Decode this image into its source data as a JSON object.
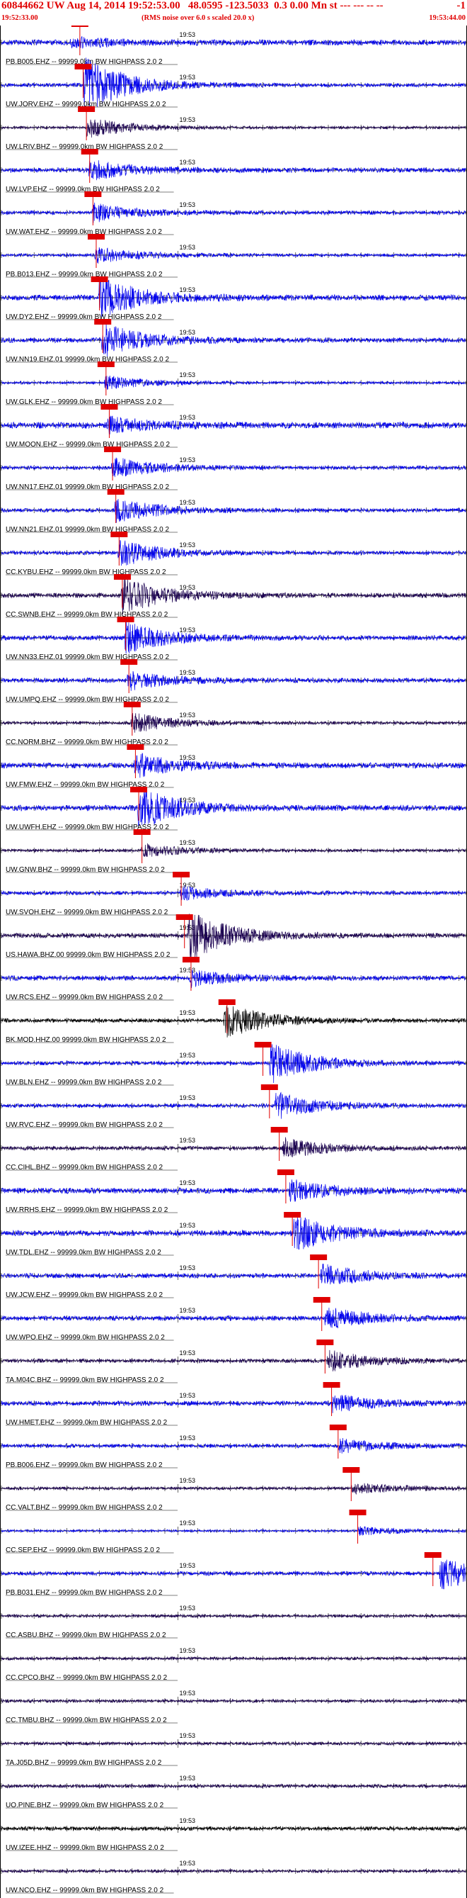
{
  "header": {
    "title": "60844662 UW Aug 14, 2014 19:52:53.00   48.0595 -123.5033  0.3 0.00 Mn st --- --- -- --",
    "tail": "-1",
    "start_time": "19:52:33.00",
    "end_time": "19:53:44.00",
    "rms_note": "(RMS noise over 6.0 s scaled 20.0 x)"
  },
  "chart_data": {
    "type": "line",
    "x_unit": "seconds after 19:52:33.00",
    "xlim": [
      0,
      71
    ],
    "minute_tick_label": "19:53",
    "minute_tick_time": 27,
    "grid": false,
    "colors": {
      "trace_blue": "#0000ee",
      "trace_dark": "#1a0050",
      "trace_black": "#000000",
      "pick_marker": "#e00000",
      "axis": "#000000"
    },
    "stations": [
      {
        "label": "PB.B005.EHZ -- 99999.0km BW  HIGHPASS  2.0  2",
        "pick": 12.0,
        "color": "blue",
        "amp": 0.7,
        "event_amp": 0.4,
        "p_arrival": 10.5
      },
      {
        "label": "UW.JORV.EHZ -- 99999.0km BW  HIGHPASS  2.0  2",
        "pick": 12.5,
        "color": "blue",
        "amp": 0.5,
        "event_amp": 2.6,
        "p_arrival": 12.5
      },
      {
        "label": "UW.LRIV.BHZ -- 99999.0km BW  HIGHPASS  2.0  2",
        "pick": 13.0,
        "color": "dark",
        "amp": 0.35,
        "event_amp": 0.9,
        "p_arrival": 12.9
      },
      {
        "label": "UW.LVP.EHZ -- 99999.0km BW  HIGHPASS  2.0  2",
        "pick": 13.5,
        "color": "blue",
        "amp": 0.6,
        "event_amp": 0.9,
        "p_arrival": 13.3
      },
      {
        "label": "UW.WAT.EHZ -- 99999.0km BW  HIGHPASS  2.0  2",
        "pick": 14.0,
        "color": "blue",
        "amp": 0.5,
        "event_amp": 0.8,
        "p_arrival": 13.8
      },
      {
        "label": "PB.B013.EHZ -- 99999.0km BW  HIGHPASS  2.0  2",
        "pick": 14.5,
        "color": "blue",
        "amp": 0.4,
        "event_amp": 0.7,
        "p_arrival": 14.3
      },
      {
        "label": "UW.DY2.EHZ -- 99999.0km BW  HIGHPASS  2.0  2",
        "pick": 15.0,
        "color": "blue",
        "amp": 0.7,
        "event_amp": 1.8,
        "p_arrival": 14.8
      },
      {
        "label": "UW.NN19.EHZ.01 99999.0km BW  HIGHPASS  2.0  2",
        "pick": 15.5,
        "color": "blue",
        "amp": 0.6,
        "event_amp": 1.5,
        "p_arrival": 15.3
      },
      {
        "label": "UW.GLK.EHZ -- 99999.0km BW  HIGHPASS  2.0  2",
        "pick": 16.0,
        "color": "blue",
        "amp": 0.35,
        "event_amp": 0.6,
        "p_arrival": 15.7
      },
      {
        "label": "UW.MOON.EHZ -- 99999.0km BW  HIGHPASS  2.0  2",
        "pick": 16.5,
        "color": "blue",
        "amp": 0.8,
        "event_amp": 0.7,
        "p_arrival": 16.2
      },
      {
        "label": "UW.NN17.EHZ.01 99999.0km BW  HIGHPASS  2.0  2",
        "pick": 17.0,
        "color": "blue",
        "amp": 0.5,
        "event_amp": 0.9,
        "p_arrival": 16.8
      },
      {
        "label": "UW.NN21.EHZ.01 99999.0km BW  HIGHPASS  2.0  2",
        "pick": 17.5,
        "color": "blue",
        "amp": 0.5,
        "event_amp": 1.1,
        "p_arrival": 17.3
      },
      {
        "label": "CC.KYBU.EHZ -- 99999.0km BW  HIGHPASS  2.0  2",
        "pick": 18.0,
        "color": "blue",
        "amp": 0.5,
        "event_amp": 1.2,
        "p_arrival": 17.8
      },
      {
        "label": "CC.SWNB.EHZ -- 99999.0km BW  HIGHPASS  2.0  2",
        "pick": 18.5,
        "color": "dark",
        "amp": 0.6,
        "event_amp": 1.6,
        "p_arrival": 18.3
      },
      {
        "label": "UW.NN33.EHZ.01 99999.0km BW  HIGHPASS  2.0  2",
        "pick": 19.0,
        "color": "blue",
        "amp": 0.6,
        "event_amp": 1.4,
        "p_arrival": 18.8
      },
      {
        "label": "UW.UMPQ.EHZ -- 99999.0km BW  HIGHPASS  2.0  2",
        "pick": 19.5,
        "color": "blue",
        "amp": 0.6,
        "event_amp": 0.8,
        "p_arrival": 19.2
      },
      {
        "label": "CC.NORM.BHZ -- 99999.0km BW  HIGHPASS  2.0  2",
        "pick": 20.0,
        "color": "dark",
        "amp": 0.4,
        "event_amp": 0.9,
        "p_arrival": 19.8
      },
      {
        "label": "UW.FMW.EHZ -- 99999.0km BW  HIGHPASS  2.0  2",
        "pick": 20.5,
        "color": "blue",
        "amp": 0.7,
        "event_amp": 1.0,
        "p_arrival": 20.3
      },
      {
        "label": "UW.UWFH.EHZ -- 99999.0km BW  HIGHPASS  2.0  2",
        "pick": 21.0,
        "color": "blue",
        "amp": 0.7,
        "event_amp": 1.8,
        "p_arrival": 20.8
      },
      {
        "label": "UW.GNW.BHZ -- 99999.0km BW  HIGHPASS  2.0  2",
        "pick": 21.5,
        "color": "dark",
        "amp": 0.4,
        "event_amp": 0.6,
        "p_arrival": 21.3
      },
      {
        "label": "UW.SVOH.EHZ -- 99999.0km BW  HIGHPASS  2.0  2",
        "pick": 27.5,
        "color": "blue",
        "amp": 0.5,
        "event_amp": 0.6,
        "p_arrival": 27.3
      },
      {
        "label": "US.HAWA.BHZ.00 99999.0km BW  HIGHPASS  2.0  2",
        "pick": 28.0,
        "color": "dark",
        "amp": 0.6,
        "event_amp": 2.2,
        "p_arrival": 28.5
      },
      {
        "label": "UW.RCS.EHZ -- 99999.0km BW  HIGHPASS  2.0  2",
        "pick": 29.0,
        "color": "blue",
        "amp": 0.6,
        "event_amp": 0.7,
        "p_arrival": 28.8
      },
      {
        "label": "BK.MOD.HHZ.00 99999.0km BW  HIGHPASS  2.0  2",
        "pick": 34.5,
        "color": "black",
        "amp": 0.5,
        "event_amp": 1.6,
        "p_arrival": 34.0
      },
      {
        "label": "UW.BLN.EHZ -- 99999.0km BW  HIGHPASS  2.0  2",
        "pick": 40.0,
        "color": "blue",
        "amp": 0.5,
        "event_amp": 1.8,
        "p_arrival": 41.0
      },
      {
        "label": "UW.RVC.EHZ -- 99999.0km BW  HIGHPASS  2.0  2",
        "pick": 41.0,
        "color": "blue",
        "amp": 0.5,
        "event_amp": 1.2,
        "p_arrival": 41.8
      },
      {
        "label": "CC.CIHL.BHZ -- 99999.0km BW  HIGHPASS  2.0  2",
        "pick": 42.5,
        "color": "dark",
        "amp": 0.5,
        "event_amp": 0.9,
        "p_arrival": 43.0
      },
      {
        "label": "UW.RRHS.EHZ -- 99999.0km BW  HIGHPASS  2.0  2",
        "pick": 43.5,
        "color": "blue",
        "amp": 0.7,
        "event_amp": 0.9,
        "p_arrival": 44.0
      },
      {
        "label": "UW.TDL.EHZ -- 99999.0km BW  HIGHPASS  2.0  2",
        "pick": 44.5,
        "color": "blue",
        "amp": 0.7,
        "event_amp": 1.6,
        "p_arrival": 44.5
      },
      {
        "label": "UW.JCW.EHZ -- 99999.0km BW  HIGHPASS  2.0  2",
        "pick": 48.5,
        "color": "blue",
        "amp": 0.6,
        "event_amp": 1.0,
        "p_arrival": 48.8
      },
      {
        "label": "UW.WPO.EHZ -- 99999.0km BW  HIGHPASS  2.0  2",
        "pick": 49.0,
        "color": "blue",
        "amp": 0.6,
        "event_amp": 1.0,
        "p_arrival": 49.4
      },
      {
        "label": "TA.M04C.BHZ -- 99999.0km BW  HIGHPASS  2.0  2",
        "pick": 49.5,
        "color": "dark",
        "amp": 0.5,
        "event_amp": 0.9,
        "p_arrival": 49.8
      },
      {
        "label": "UW.HMET.EHZ -- 99999.0km BW  HIGHPASS  2.0  2",
        "pick": 50.5,
        "color": "blue",
        "amp": 0.6,
        "event_amp": 0.8,
        "p_arrival": 50.5
      },
      {
        "label": "PB.B006.EHZ -- 99999.0km BW  HIGHPASS  2.0  2",
        "pick": 51.5,
        "color": "blue",
        "amp": 0.5,
        "event_amp": 0.6,
        "p_arrival": 51.5
      },
      {
        "label": "CC.VALT.BHZ -- 99999.0km BW  HIGHPASS  2.0  2",
        "pick": 53.5,
        "color": "dark",
        "amp": 0.4,
        "event_amp": 0.5,
        "p_arrival": 53.5
      },
      {
        "label": "CC.SEP.EHZ -- 99999.0km BW  HIGHPASS  2.0  2",
        "pick": 54.5,
        "color": "blue",
        "amp": 0.3,
        "event_amp": 0.4,
        "p_arrival": 54.5
      },
      {
        "label": "PB.B031.EHZ -- 99999.0km BW  HIGHPASS  2.0  2",
        "pick": 66.0,
        "color": "blue",
        "amp": 0.5,
        "event_amp": 1.4,
        "p_arrival": 67.0
      },
      {
        "label": "CC.ASBU.BHZ -- 99999.0km BW  HIGHPASS  2.0  2",
        "pick": null,
        "color": "dark",
        "amp": 0.4,
        "event_amp": 0,
        "p_arrival": null
      },
      {
        "label": "CC.CPCO.BHZ -- 99999.0km BW  HIGHPASS  2.0  2",
        "pick": null,
        "color": "dark",
        "amp": 0.4,
        "event_amp": 0,
        "p_arrival": null
      },
      {
        "label": "CC.TMBU.BHZ -- 99999.0km BW  HIGHPASS  2.0  2",
        "pick": null,
        "color": "dark",
        "amp": 0.4,
        "event_amp": 0,
        "p_arrival": null
      },
      {
        "label": "TA.J05D.BHZ -- 99999.0km BW  HIGHPASS  2.0  2",
        "pick": null,
        "color": "dark",
        "amp": 0.4,
        "event_amp": 0,
        "p_arrival": null
      },
      {
        "label": "UO.PINE.BHZ -- 99999.0km BW  HIGHPASS  2.0  2",
        "pick": null,
        "color": "dark",
        "amp": 0.45,
        "event_amp": 0,
        "p_arrival": null
      },
      {
        "label": "UW.IZEE.HHZ -- 99999.0km BW  HIGHPASS  2.0  2",
        "pick": null,
        "color": "black",
        "amp": 0.5,
        "event_amp": 0,
        "p_arrival": null
      },
      {
        "label": "UW.NCO.EHZ -- 99999.0km BW  HIGHPASS  2.0  2",
        "pick": null,
        "color": "dark",
        "amp": 0.4,
        "event_amp": 0,
        "p_arrival": null
      }
    ]
  }
}
